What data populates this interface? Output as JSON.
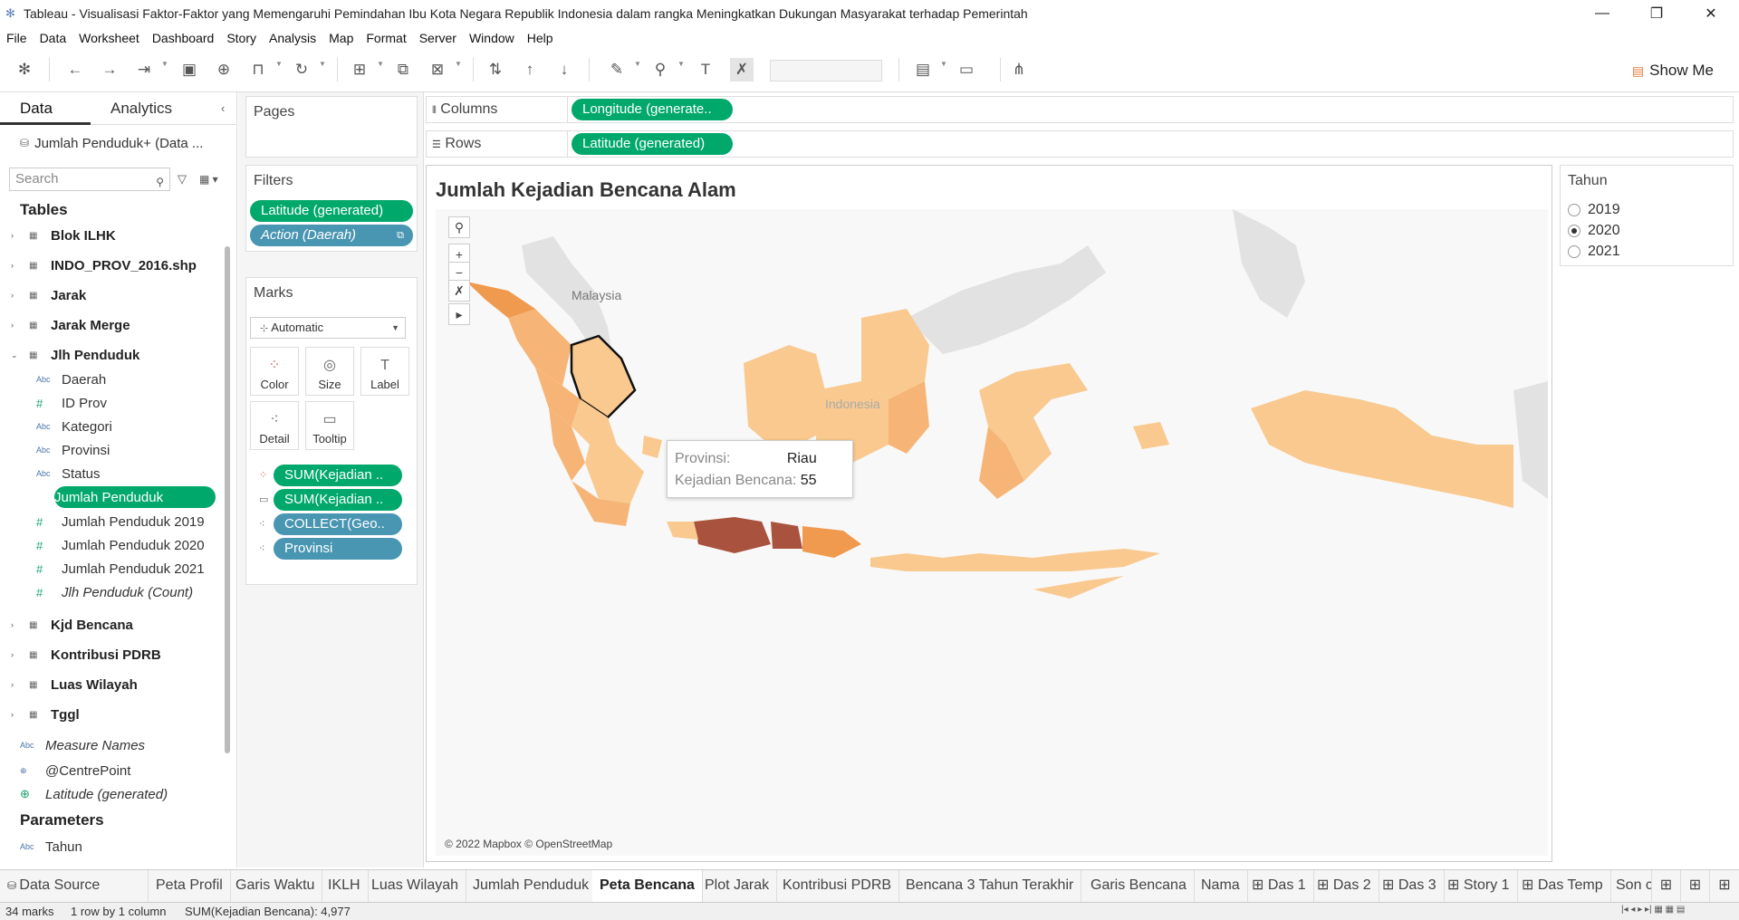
{
  "window": {
    "title": "Tableau - Visualisasi Faktor-Faktor yang Memengaruhi Pemindahan Ibu Kota Negara Republik Indonesia dalam rangka Meningkatkan Dukungan Masyarakat terhadap Pemerintah"
  },
  "menu": [
    "File",
    "Data",
    "Worksheet",
    "Dashboard",
    "Story",
    "Analysis",
    "Map",
    "Format",
    "Server",
    "Window",
    "Help"
  ],
  "toolbar": {
    "show_me": "Show Me"
  },
  "left": {
    "tab_data": "Data",
    "tab_analytics": "Analytics",
    "source": "Jumlah Penduduk+ (Data ...",
    "search_placeholder": "Search",
    "tables_heading": "Tables",
    "tables": [
      "Blok ILHK",
      "INDO_PROV_2016.shp",
      "Jarak",
      "Jarak Merge",
      "Jlh Penduduk"
    ],
    "fields": [
      {
        "type": "Abc",
        "name": "Daerah"
      },
      {
        "type": "#",
        "name": "ID Prov"
      },
      {
        "type": "Abc",
        "name": "Kategori"
      },
      {
        "type": "Abc",
        "name": "Provinsi"
      },
      {
        "type": "Abc",
        "name": "Status"
      },
      {
        "type": "#",
        "name": "Jumlah Penduduk"
      },
      {
        "type": "#",
        "name": "Jumlah Penduduk 2019"
      },
      {
        "type": "#",
        "name": "Jumlah Penduduk 2020"
      },
      {
        "type": "#",
        "name": "Jumlah Penduduk 2021"
      },
      {
        "type": "#",
        "name": "Jlh Penduduk (Count)"
      }
    ],
    "tables2": [
      "Kjd Bencana",
      "Kontribusi PDRB",
      "Luas Wilayah",
      "Tggl"
    ],
    "extra_fields": [
      "Measure Names",
      "@CentrePoint",
      "Latitude (generated)"
    ],
    "params_heading": "Parameters",
    "param": "Tahun"
  },
  "cards": {
    "pages": "Pages",
    "filters": "Filters",
    "filter_items": [
      "Latitude (generated)",
      "Action (Daerah)"
    ],
    "marks": "Marks",
    "mark_type": "Automatic",
    "buttons": [
      "Color",
      "Size",
      "Label",
      "Detail",
      "Tooltip"
    ],
    "mark_pills": [
      "SUM(Kejadian ..",
      "SUM(Kejadian ..",
      "COLLECT(Geo..",
      "Provinsi"
    ]
  },
  "shelves": {
    "columns_label": "Columns",
    "columns_pill": "Longitude (generate..",
    "rows_label": "Rows",
    "rows_pill": "Latitude (generated)"
  },
  "view": {
    "title": "Jumlah Kejadian Bencana Alam",
    "label_malaysia": "Malaysia",
    "label_indonesia": "Indonesia",
    "copyright": "© 2022 Mapbox © OpenStreetMap",
    "tooltip": {
      "k1": "Provinsi:",
      "v1": "Riau",
      "k2": "Kejadian Bencana:",
      "v2": "55"
    }
  },
  "legend": {
    "title": "Tahun",
    "options": [
      "2019",
      "2020",
      "2021"
    ],
    "selected": "2020"
  },
  "sheet_tabs": [
    "Data Source",
    "Peta Profil",
    "Garis Waktu",
    "IKLH",
    "Luas Wilayah",
    "Jumlah Penduduk",
    "Peta Bencana",
    "Plot Jarak",
    "Kontribusi PDRB",
    "Bencana 3 Tahun Terakhir",
    "Garis Bencana",
    "Nama",
    "Das 1",
    "Das 2",
    "Das 3",
    "Story 1",
    "Das Temp",
    "Son c"
  ],
  "active_tab": "Peta Bencana",
  "status": {
    "marks": "34 marks",
    "rows": "1 row by 1 column",
    "sum": "SUM(Kejadian Bencana): 4,977"
  },
  "colors": {
    "green_pill": "#00a86b",
    "blue_pill": "#4996b2",
    "low": "#f9c98f",
    "mid": "#ef9a4f",
    "high": "#a9533e"
  }
}
